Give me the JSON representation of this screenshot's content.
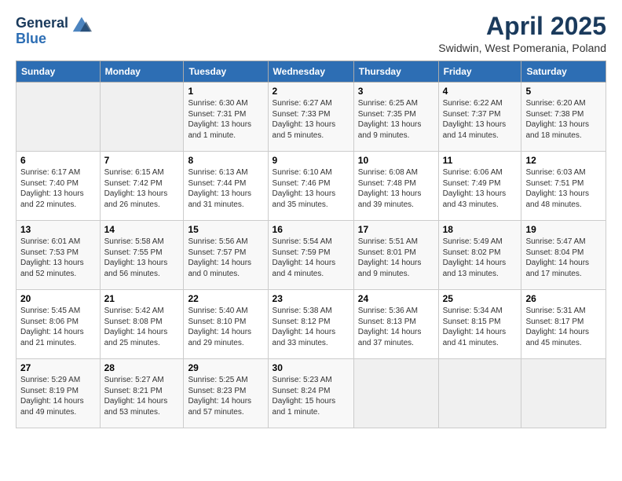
{
  "header": {
    "logo_line1": "General",
    "logo_line2": "Blue",
    "title": "April 2025",
    "subtitle": "Swidwin, West Pomerania, Poland"
  },
  "weekdays": [
    "Sunday",
    "Monday",
    "Tuesday",
    "Wednesday",
    "Thursday",
    "Friday",
    "Saturday"
  ],
  "weeks": [
    [
      {
        "day": "",
        "info": ""
      },
      {
        "day": "",
        "info": ""
      },
      {
        "day": "1",
        "info": "Sunrise: 6:30 AM\nSunset: 7:31 PM\nDaylight: 13 hours and 1 minute."
      },
      {
        "day": "2",
        "info": "Sunrise: 6:27 AM\nSunset: 7:33 PM\nDaylight: 13 hours and 5 minutes."
      },
      {
        "day": "3",
        "info": "Sunrise: 6:25 AM\nSunset: 7:35 PM\nDaylight: 13 hours and 9 minutes."
      },
      {
        "day": "4",
        "info": "Sunrise: 6:22 AM\nSunset: 7:37 PM\nDaylight: 13 hours and 14 minutes."
      },
      {
        "day": "5",
        "info": "Sunrise: 6:20 AM\nSunset: 7:38 PM\nDaylight: 13 hours and 18 minutes."
      }
    ],
    [
      {
        "day": "6",
        "info": "Sunrise: 6:17 AM\nSunset: 7:40 PM\nDaylight: 13 hours and 22 minutes."
      },
      {
        "day": "7",
        "info": "Sunrise: 6:15 AM\nSunset: 7:42 PM\nDaylight: 13 hours and 26 minutes."
      },
      {
        "day": "8",
        "info": "Sunrise: 6:13 AM\nSunset: 7:44 PM\nDaylight: 13 hours and 31 minutes."
      },
      {
        "day": "9",
        "info": "Sunrise: 6:10 AM\nSunset: 7:46 PM\nDaylight: 13 hours and 35 minutes."
      },
      {
        "day": "10",
        "info": "Sunrise: 6:08 AM\nSunset: 7:48 PM\nDaylight: 13 hours and 39 minutes."
      },
      {
        "day": "11",
        "info": "Sunrise: 6:06 AM\nSunset: 7:49 PM\nDaylight: 13 hours and 43 minutes."
      },
      {
        "day": "12",
        "info": "Sunrise: 6:03 AM\nSunset: 7:51 PM\nDaylight: 13 hours and 48 minutes."
      }
    ],
    [
      {
        "day": "13",
        "info": "Sunrise: 6:01 AM\nSunset: 7:53 PM\nDaylight: 13 hours and 52 minutes."
      },
      {
        "day": "14",
        "info": "Sunrise: 5:58 AM\nSunset: 7:55 PM\nDaylight: 13 hours and 56 minutes."
      },
      {
        "day": "15",
        "info": "Sunrise: 5:56 AM\nSunset: 7:57 PM\nDaylight: 14 hours and 0 minutes."
      },
      {
        "day": "16",
        "info": "Sunrise: 5:54 AM\nSunset: 7:59 PM\nDaylight: 14 hours and 4 minutes."
      },
      {
        "day": "17",
        "info": "Sunrise: 5:51 AM\nSunset: 8:01 PM\nDaylight: 14 hours and 9 minutes."
      },
      {
        "day": "18",
        "info": "Sunrise: 5:49 AM\nSunset: 8:02 PM\nDaylight: 14 hours and 13 minutes."
      },
      {
        "day": "19",
        "info": "Sunrise: 5:47 AM\nSunset: 8:04 PM\nDaylight: 14 hours and 17 minutes."
      }
    ],
    [
      {
        "day": "20",
        "info": "Sunrise: 5:45 AM\nSunset: 8:06 PM\nDaylight: 14 hours and 21 minutes."
      },
      {
        "day": "21",
        "info": "Sunrise: 5:42 AM\nSunset: 8:08 PM\nDaylight: 14 hours and 25 minutes."
      },
      {
        "day": "22",
        "info": "Sunrise: 5:40 AM\nSunset: 8:10 PM\nDaylight: 14 hours and 29 minutes."
      },
      {
        "day": "23",
        "info": "Sunrise: 5:38 AM\nSunset: 8:12 PM\nDaylight: 14 hours and 33 minutes."
      },
      {
        "day": "24",
        "info": "Sunrise: 5:36 AM\nSunset: 8:13 PM\nDaylight: 14 hours and 37 minutes."
      },
      {
        "day": "25",
        "info": "Sunrise: 5:34 AM\nSunset: 8:15 PM\nDaylight: 14 hours and 41 minutes."
      },
      {
        "day": "26",
        "info": "Sunrise: 5:31 AM\nSunset: 8:17 PM\nDaylight: 14 hours and 45 minutes."
      }
    ],
    [
      {
        "day": "27",
        "info": "Sunrise: 5:29 AM\nSunset: 8:19 PM\nDaylight: 14 hours and 49 minutes."
      },
      {
        "day": "28",
        "info": "Sunrise: 5:27 AM\nSunset: 8:21 PM\nDaylight: 14 hours and 53 minutes."
      },
      {
        "day": "29",
        "info": "Sunrise: 5:25 AM\nSunset: 8:23 PM\nDaylight: 14 hours and 57 minutes."
      },
      {
        "day": "30",
        "info": "Sunrise: 5:23 AM\nSunset: 8:24 PM\nDaylight: 15 hours and 1 minute."
      },
      {
        "day": "",
        "info": ""
      },
      {
        "day": "",
        "info": ""
      },
      {
        "day": "",
        "info": ""
      }
    ]
  ]
}
